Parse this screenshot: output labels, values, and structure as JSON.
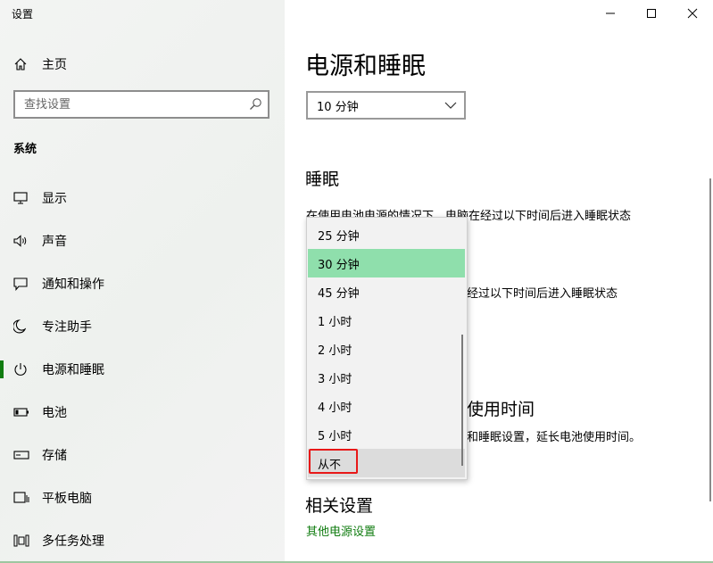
{
  "window": {
    "title": "设置",
    "controls": [
      "minimize-icon",
      "maximize-icon",
      "close-icon"
    ]
  },
  "sidebar": {
    "home_label": "主页",
    "search_placeholder": "查找设置",
    "section_title": "系统",
    "items": [
      {
        "label": "显示",
        "icon": "monitor-icon"
      },
      {
        "label": "声音",
        "icon": "speaker-icon"
      },
      {
        "label": "通知和操作",
        "icon": "notification-icon"
      },
      {
        "label": "专注助手",
        "icon": "moon-icon"
      },
      {
        "label": "电源和睡眠",
        "icon": "power-icon",
        "active": true
      },
      {
        "label": "电池",
        "icon": "battery-icon"
      },
      {
        "label": "存储",
        "icon": "storage-icon"
      },
      {
        "label": "平板电脑",
        "icon": "tablet-icon"
      },
      {
        "label": "多任务处理",
        "icon": "multitask-icon"
      }
    ]
  },
  "main": {
    "page_title": "电源和睡眠",
    "screen_select_value": "10 分钟",
    "sleep_heading": "睡眠",
    "sleep_desc_battery": "在使用电池电源的情况下，电脑在经过以下时间后进入睡眠状态",
    "sleep_desc_plugged_partial": "经过以下时间后进入睡眠状态",
    "battery_heading_partial": "使用时间",
    "battery_desc_partial": "和睡眠设置，延长电池使用时间。",
    "related_heading": "相关设置",
    "related_link": "其他电源设置"
  },
  "dropdown": {
    "selected": "30 分钟",
    "options": [
      "25 分钟",
      "30 分钟",
      "45 分钟",
      "1 小时",
      "2 小时",
      "3 小时",
      "4 小时",
      "5 小时",
      "从不"
    ],
    "highlighted_option": "从不"
  },
  "colors": {
    "accent": "#107c10",
    "selected_option": "#8fdfac",
    "highlight_box": "#e81818"
  }
}
